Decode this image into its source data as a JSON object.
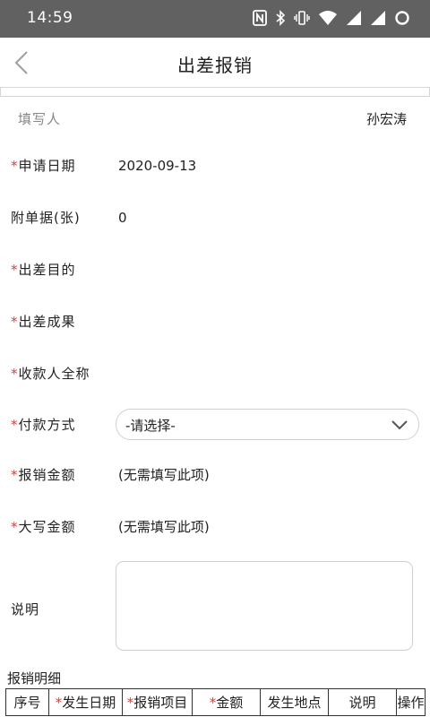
{
  "status_bar": {
    "time": "14:59",
    "icons": [
      "nfc-icon",
      "bluetooth-icon",
      "vibrate-icon",
      "wifi-icon",
      "signal-icon",
      "signal-icon",
      "loading-icon"
    ]
  },
  "header": {
    "title": "出差报销",
    "back_icon": "chevron-left-icon"
  },
  "form": {
    "filler_label": "填写人",
    "filler_value": "孙宏涛",
    "required_mark": "*",
    "apply_date_label": "申请日期",
    "apply_date_value": "2020-09-13",
    "attachments_label": "附单据(张)",
    "attachments_value": "0",
    "purpose_label": "出差目的",
    "result_label": "出差成果",
    "payee_label": "收款人全称",
    "payment_method_label": "付款方式",
    "payment_method_selected": "-请选择-",
    "reimburse_amount_label": "报销金额",
    "reimburse_amount_value": "(无需填写此项)",
    "amount_uppercase_label": "大写金额",
    "amount_uppercase_value": "(无需填写此项)",
    "note_label": "说明",
    "note_value": ""
  },
  "details": {
    "title": "报销明细",
    "columns": [
      {
        "label": "序号",
        "required": false
      },
      {
        "label": "发生日期",
        "required": true
      },
      {
        "label": "报销项目",
        "required": true
      },
      {
        "label": "金额",
        "required": true
      },
      {
        "label": "发生地点",
        "required": false
      },
      {
        "label": "说明",
        "required": false
      },
      {
        "label": "操作",
        "required": false
      }
    ]
  },
  "colors": {
    "status_bar": "#616161",
    "required": "#e53935",
    "muted_label": "#888888",
    "border": "#cfcfcf"
  }
}
